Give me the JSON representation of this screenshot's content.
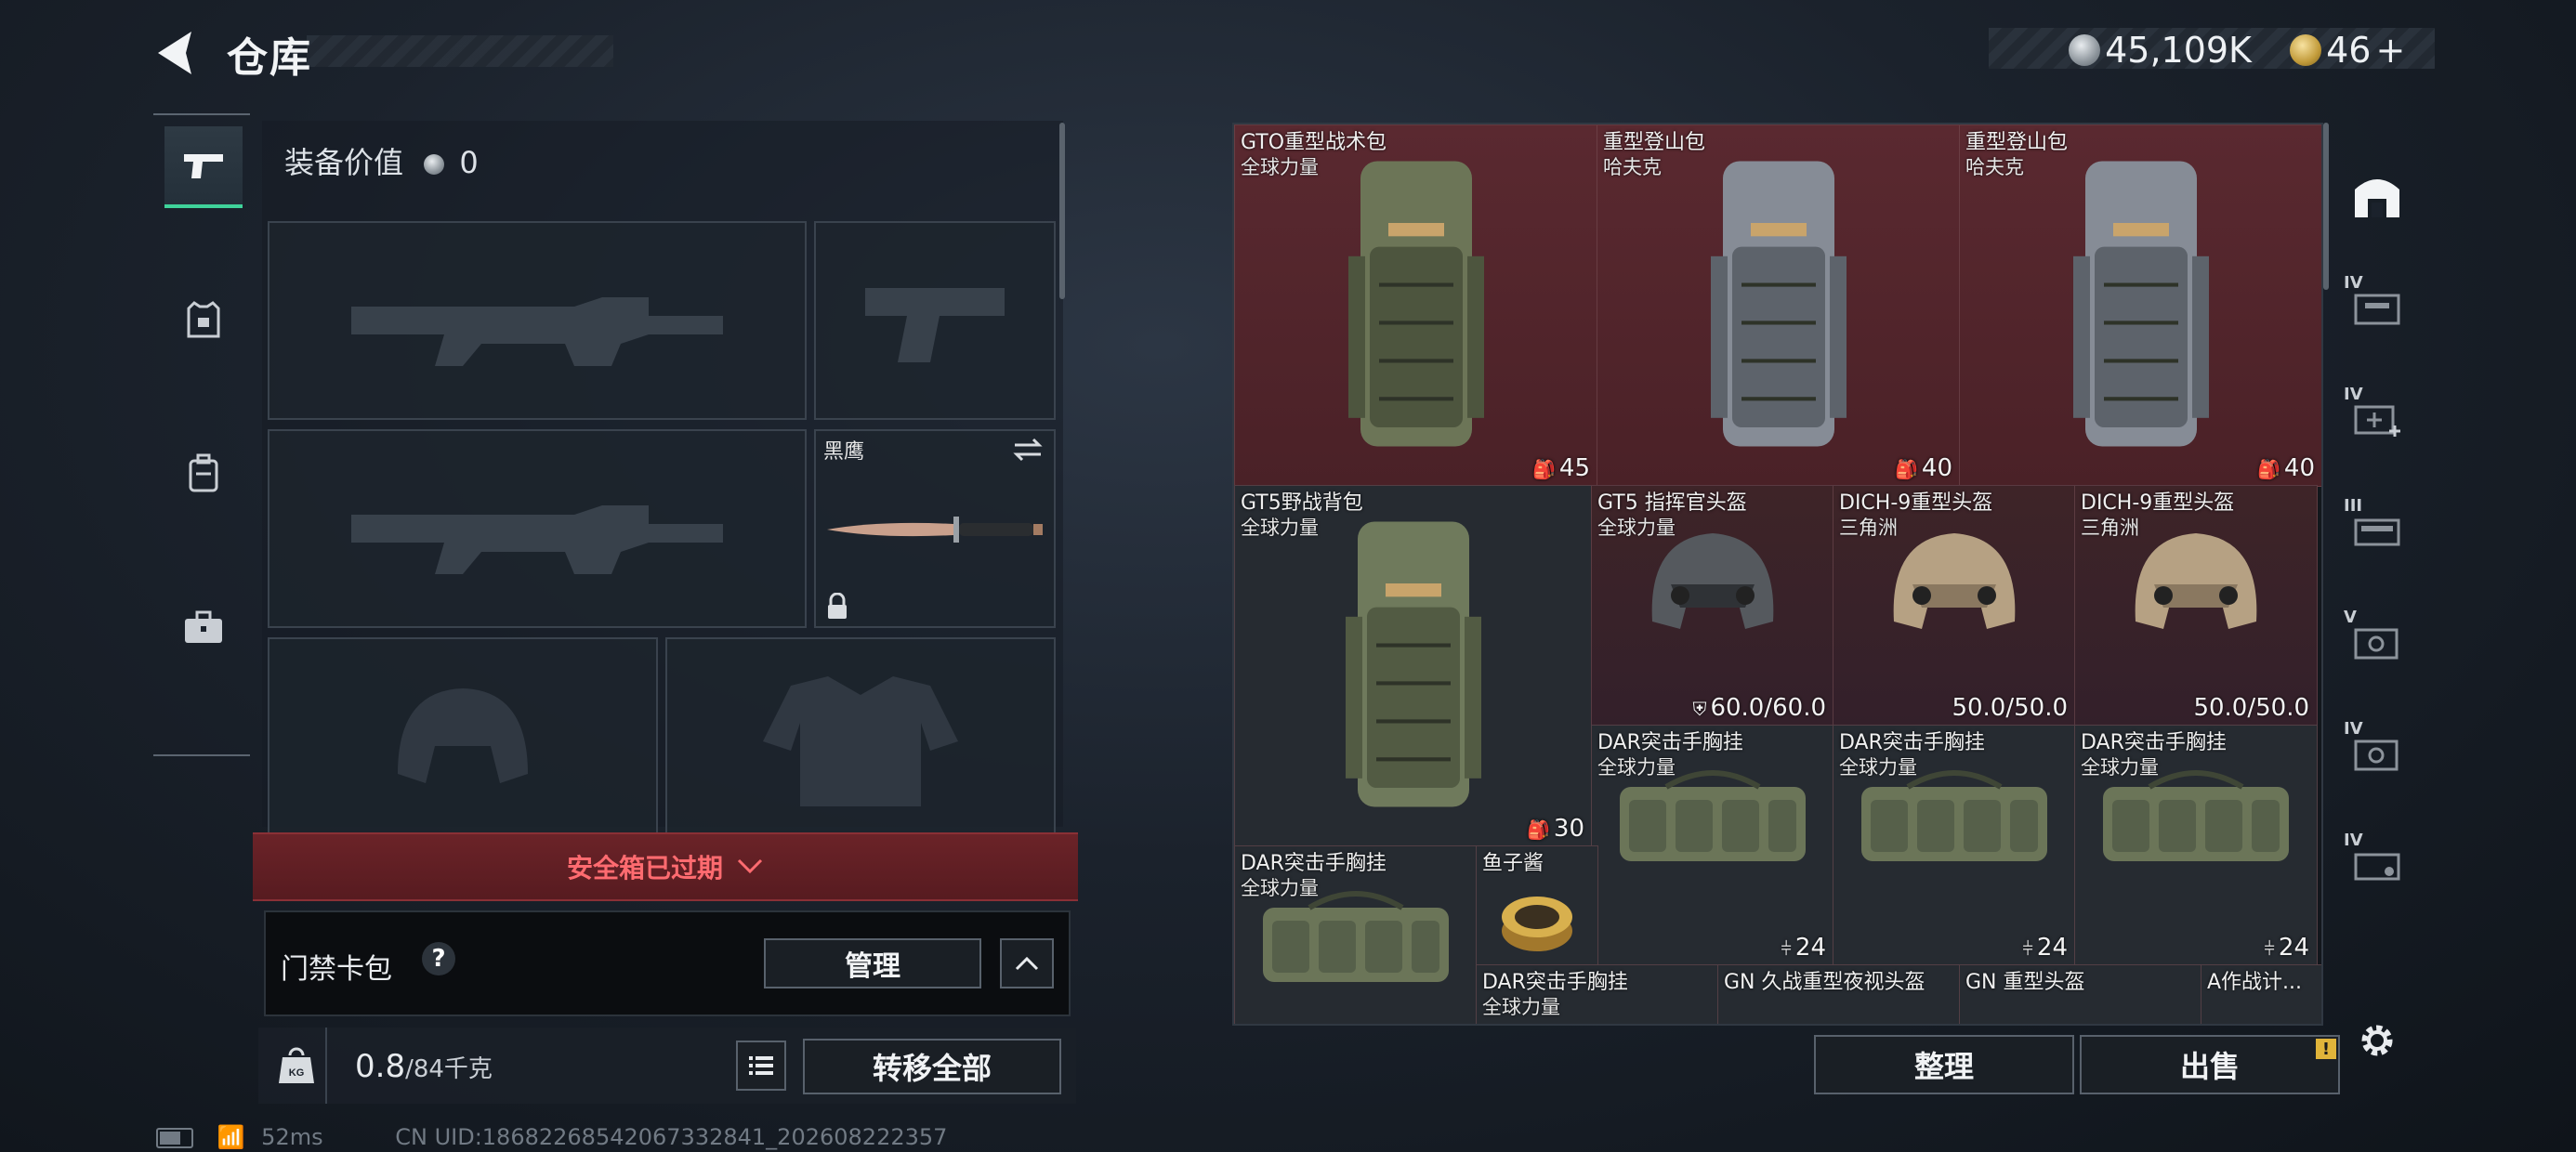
{
  "header": {
    "title": "仓库",
    "silver_amount": "45,109K",
    "gold_amount": "46",
    "gold_plus": "+"
  },
  "left": {
    "equip_value_label": "装备价值",
    "equip_value": "0",
    "knife_name": "黑鹰",
    "safe_box_status": "安全箱已过期",
    "card_pack_label": "门禁卡包",
    "card_pack_help": "?",
    "manage_button": "管理",
    "weight_current": "0.8",
    "weight_max": "/84千克",
    "transfer_all_button": "转移全部"
  },
  "status_bar": {
    "ping": "52ms",
    "uid": "CN UID:18682268542067332841_202608222357"
  },
  "grid": {
    "items": [
      {
        "name": "GTO重型战术包",
        "sub": "全球力量",
        "value": "45",
        "value_icon": "backpack-icon"
      },
      {
        "name": "重型登山包",
        "sub": "哈夫克",
        "value": "40",
        "value_icon": "backpack-icon"
      },
      {
        "name": "重型登山包",
        "sub": "哈夫克",
        "value": "40",
        "value_icon": "backpack-icon"
      },
      {
        "name": "GT5野战背包",
        "sub": "全球力量",
        "value": "30",
        "value_icon": "backpack-icon"
      },
      {
        "name": "GT5 指挥官头盔",
        "sub": "全球力量",
        "value": "60.0/60.0",
        "value_icon": "durability-icon"
      },
      {
        "name": "DICH-9重型头盔",
        "sub": "三角洲",
        "value": "50.0/50.0",
        "value_icon": ""
      },
      {
        "name": "DICH-9重型头盔",
        "sub": "三角洲",
        "value": "50.0/50.0",
        "value_icon": ""
      },
      {
        "name": "DAR突击手胸挂",
        "sub": "全球力量",
        "value": "24",
        "value_icon": "vest-icon"
      },
      {
        "name": "DAR突击手胸挂",
        "sub": "全球力量",
        "value": "24",
        "value_icon": "vest-icon"
      },
      {
        "name": "DAR突击手胸挂",
        "sub": "全球力量",
        "value": "24",
        "value_icon": "vest-icon"
      },
      {
        "name": "DAR突击手胸挂",
        "sub": "全球力量",
        "value": "",
        "value_icon": ""
      },
      {
        "name": "鱼子酱",
        "sub": "",
        "value": "",
        "value_icon": ""
      },
      {
        "name": "DAR突击手胸挂",
        "sub": "全球力量",
        "value": "",
        "value_icon": ""
      },
      {
        "name": "GN 久战重型夜视头盔",
        "sub": "",
        "value": "",
        "value_icon": ""
      },
      {
        "name": "GN 重型头盔",
        "sub": "",
        "value": "",
        "value_icon": ""
      },
      {
        "name": "A作战计...",
        "sub": "",
        "value": "",
        "value_icon": ""
      }
    ]
  },
  "right_rail": {
    "tiers": [
      "IV",
      "IV",
      "III",
      "V",
      "IV",
      "IV"
    ]
  },
  "bottom": {
    "sort_button": "整理",
    "sell_button": "出售",
    "sell_alert": "!"
  },
  "colors": {
    "accent_green": "#3fd39a",
    "safe_red": "#ff6b70",
    "item_red_bg": "#5a2930"
  }
}
